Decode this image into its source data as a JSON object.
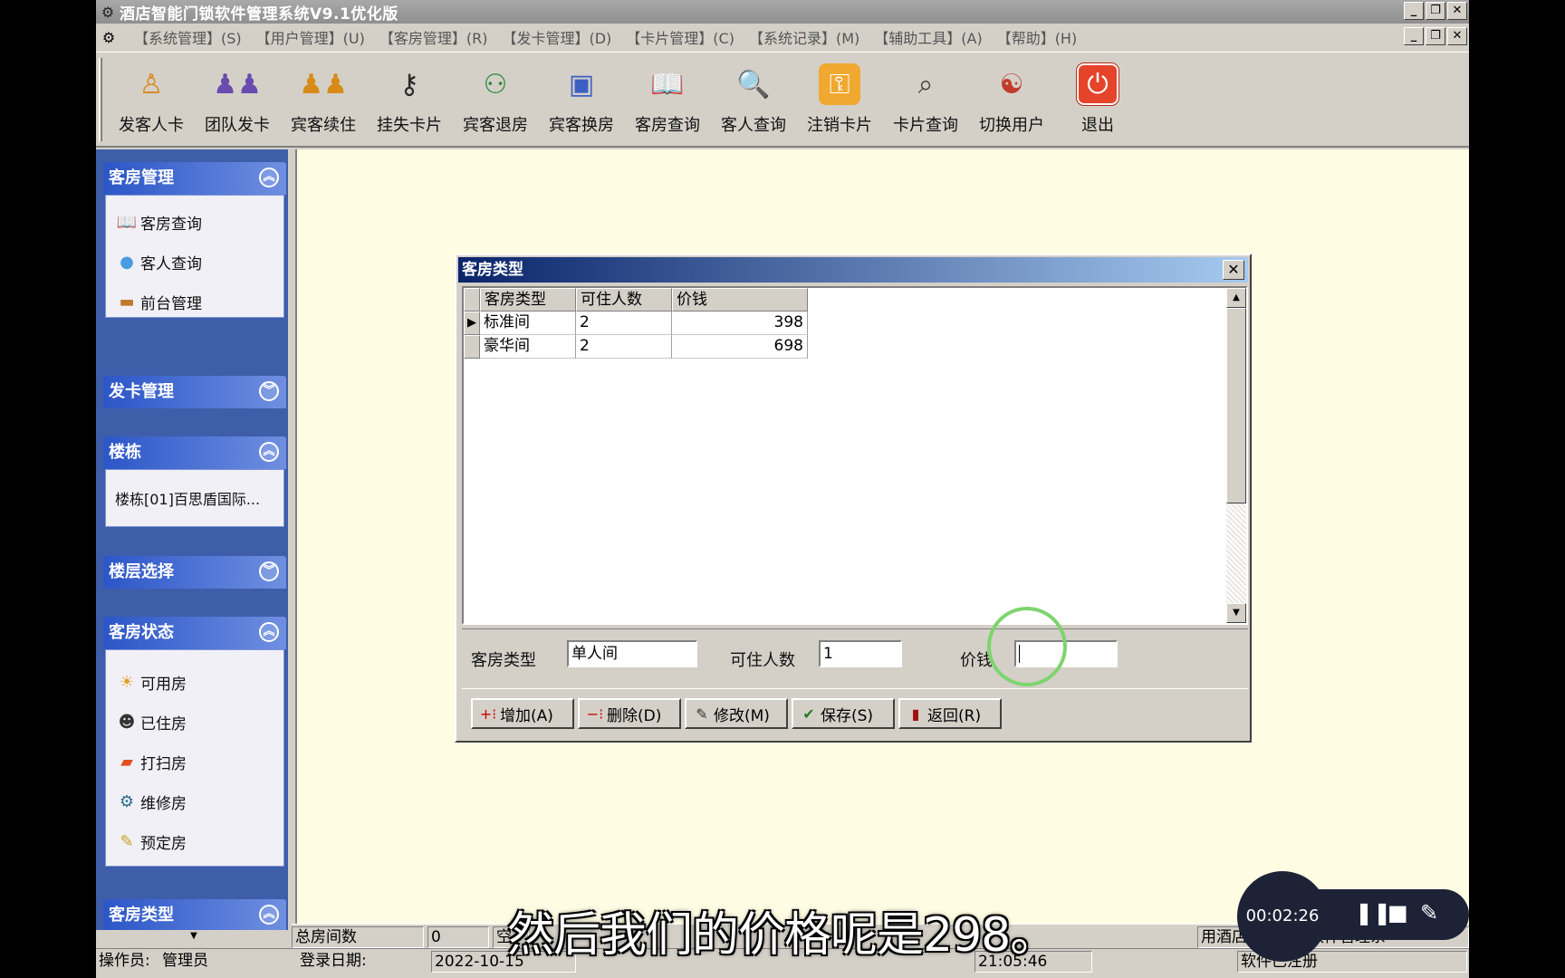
{
  "window": {
    "title": "酒店智能门锁软件管理系统V9.1优化版"
  },
  "menu": [
    "【系统管理】(S)",
    "【用户管理】(U)",
    "【客房管理】(R)",
    "【发卡管理】(D)",
    "【卡片管理】(C)",
    "【系统记录】(M)",
    "【辅助工具】(A)",
    "【帮助】(H)"
  ],
  "toolbar": [
    "发客人卡",
    "团队发卡",
    "宾客续住",
    "挂失卡片",
    "宾客退房",
    "宾客换房",
    "客房查询",
    "客人查询",
    "注销卡片",
    "卡片查询",
    "切换用户",
    "退出"
  ],
  "sidebar": {
    "room_mgmt": {
      "title": "客房管理",
      "items": [
        "客房查询",
        "客人查询",
        "前台管理"
      ]
    },
    "card_mgmt": {
      "title": "发卡管理"
    },
    "building": {
      "title": "楼栋",
      "items": [
        "楼栋[01]百思盾国际..."
      ]
    },
    "floor": {
      "title": "楼层选择"
    },
    "room_status": {
      "title": "客房状态",
      "items": [
        "可用房",
        "已住房",
        "打扫房",
        "维修房",
        "预定房"
      ]
    },
    "room_type": {
      "title": "客房类型"
    }
  },
  "dialog": {
    "title": "客房类型",
    "columns": [
      "客房类型",
      "可住人数",
      "价钱"
    ],
    "rows": [
      {
        "type": "标准间",
        "capacity": "2",
        "price": "398"
      },
      {
        "type": "豪华间",
        "capacity": "2",
        "price": "698"
      }
    ],
    "form": {
      "type_label": "客房类型",
      "type_value": "单人间",
      "capacity_label": "可住人数",
      "capacity_value": "1",
      "price_label": "价钱",
      "price_value": ""
    },
    "buttons": [
      "增加(A)",
      "删除(D)",
      "修改(M)",
      "保存(S)",
      "返回(R)"
    ]
  },
  "status": {
    "total_rooms_label": "总房间数",
    "total_rooms_value": "0",
    "empty_label": "空",
    "app_name_fragment": "用酒店智能门锁软件管理系",
    "operator_label": "操作员:",
    "operator_value": "管理员",
    "login_date_label": "登录日期:",
    "login_date_value": "2022-10-15",
    "login_time_value": "21:05:46",
    "register_fragment": "软件已注册"
  },
  "overlay": {
    "subtitle": "然后我们的价格呢是298。",
    "timer": "00:02:26"
  },
  "colors": {
    "sidebar_bg": "#3e5ea9",
    "workspace_bg": "#fefce3",
    "dialog_title": "#0a246a",
    "cursor_ring": "#7ed46e"
  }
}
